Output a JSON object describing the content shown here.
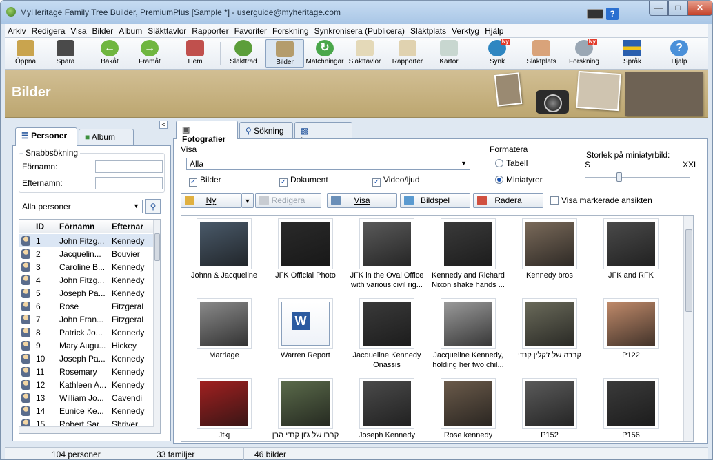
{
  "window": {
    "title": "MyHeritage Family Tree Builder, PremiumPlus [Sample *] - userguide@myheritage.com"
  },
  "menu": [
    "Arkiv",
    "Redigera",
    "Visa",
    "Bilder",
    "Album",
    "Släkttavlor",
    "Rapporter",
    "Favoriter",
    "Forskning",
    "Synkronisera (Publicera)",
    "Släktplats",
    "Verktyg",
    "Hjälp"
  ],
  "toolbar": {
    "open": "Öppna",
    "save": "Spara",
    "back": "Bakåt",
    "forward": "Framåt",
    "home": "Hem",
    "tree": "Släktträd",
    "photos": "Bilder",
    "matches": "Matchningar",
    "charts": "Släkttavlor",
    "reports": "Rapporter",
    "maps": "Kartor",
    "sync": "Synk",
    "familysite": "Släktplats",
    "research": "Forskning",
    "language": "Språk",
    "help": "Hjälp",
    "badge_new": "Ny"
  },
  "banner": {
    "title": "Bilder"
  },
  "left": {
    "tab_people": "Personer",
    "tab_album": "Album",
    "quicksearch": "Snabbsökning",
    "firstname": "Förnamn:",
    "lastname": "Efternamn:",
    "filter": "Alla personer",
    "headers": {
      "id": "ID",
      "first": "Förnamn",
      "last": "Efternar"
    },
    "rows": [
      {
        "id": "1",
        "first": "John Fitzg...",
        "last": "Kennedy"
      },
      {
        "id": "2",
        "first": "Jacquelin...",
        "last": "Bouvier"
      },
      {
        "id": "3",
        "first": "Caroline B...",
        "last": "Kennedy"
      },
      {
        "id": "4",
        "first": "John Fitzg...",
        "last": "Kennedy"
      },
      {
        "id": "5",
        "first": "Joseph Pa...",
        "last": "Kennedy"
      },
      {
        "id": "6",
        "first": "Rose",
        "last": "Fitzgeral"
      },
      {
        "id": "7",
        "first": "John Fran...",
        "last": "Fitzgeral"
      },
      {
        "id": "8",
        "first": "Patrick Jo...",
        "last": "Kennedy"
      },
      {
        "id": "9",
        "first": "Mary Augu...",
        "last": "Hickey"
      },
      {
        "id": "10",
        "first": "Joseph Pa...",
        "last": "Kennedy"
      },
      {
        "id": "11",
        "first": "Rosemary",
        "last": "Kennedy"
      },
      {
        "id": "12",
        "first": "Kathleen A...",
        "last": "Kennedy"
      },
      {
        "id": "13",
        "first": "William Jo...",
        "last": "Cavendi"
      },
      {
        "id": "14",
        "first": "Eunice Ke...",
        "last": "Kennedy"
      },
      {
        "id": "15",
        "first": "Robert Sar...",
        "last": "Shriver"
      }
    ]
  },
  "right": {
    "tab_photos": "Fotografier",
    "tab_search": "Sökning",
    "tab_import": "Importera",
    "show_label": "Visa",
    "show_value": "Alla",
    "chk_photos": "Bilder",
    "chk_docs": "Dokument",
    "chk_video": "Video/ljud",
    "format_label": "Formatera",
    "radio_table": "Tabell",
    "radio_thumbs": "Miniatyrer",
    "size_label": "Storlek på miniatyrbild:",
    "size_s": "S",
    "size_xxl": "XXL",
    "btn_new": "Ny",
    "btn_edit": "Redigera",
    "btn_view": "Visa",
    "btn_slideshow": "Bildspel",
    "btn_delete": "Radera",
    "chk_faces": "Visa markerade ansikten",
    "thumbs": [
      {
        "caption": "Johnn & Jacqueline"
      },
      {
        "caption": "JFK Official Photo"
      },
      {
        "caption": "JFK in the Oval Office with various civil rig..."
      },
      {
        "caption": "Kennedy and Richard Nixon shake hands ..."
      },
      {
        "caption": "Kennedy bros"
      },
      {
        "caption": "JFK and RFK"
      },
      {
        "caption": "Marriage"
      },
      {
        "caption": "Warren Report"
      },
      {
        "caption": "Jacqueline Kennedy Onassis"
      },
      {
        "caption": "Jacqueline Kennedy, holding her two chil..."
      },
      {
        "caption": "קברה של ז'קלין קנדי"
      },
      {
        "caption": "P122"
      },
      {
        "caption": "Jfkj"
      },
      {
        "caption": "קברו של ג'ון קנדי הבן"
      },
      {
        "caption": "Joseph Kennedy"
      },
      {
        "caption": "Rose kennedy"
      },
      {
        "caption": "P152"
      },
      {
        "caption": "P156"
      }
    ]
  },
  "status": {
    "people": "104 personer",
    "families": "33 familjer",
    "photos": "46 bilder"
  }
}
